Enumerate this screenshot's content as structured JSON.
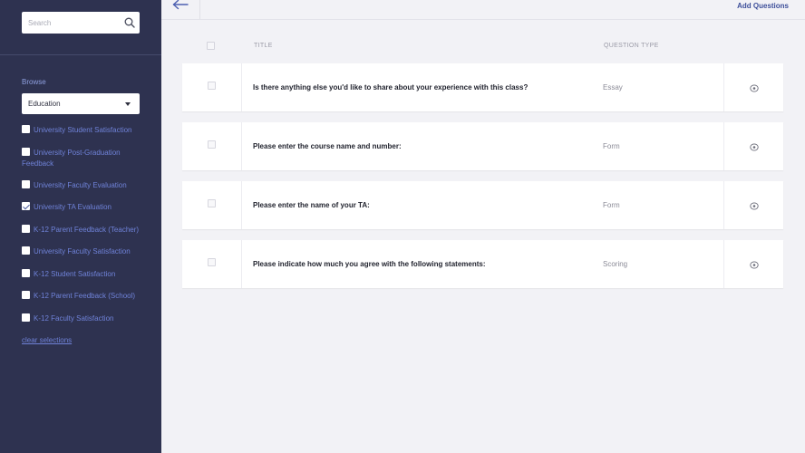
{
  "sidebar": {
    "search": {
      "placeholder": "Search"
    },
    "browse_label": "Browse",
    "category_select": {
      "selected": "Education"
    },
    "categories": [
      {
        "label": "University Student Satisfaction",
        "checked": false
      },
      {
        "label": "University Post-Graduation Feedback",
        "checked": false
      },
      {
        "label": "University Faculty Evaluation",
        "checked": false
      },
      {
        "label": "University TA Evaluation",
        "checked": true
      },
      {
        "label": "K-12 Parent Feedback (Teacher)",
        "checked": false
      },
      {
        "label": "University Faculty Satisfaction",
        "checked": false
      },
      {
        "label": "K-12 Student Satisfaction",
        "checked": false
      },
      {
        "label": "K-12 Parent Feedback (School)",
        "checked": false
      },
      {
        "label": "K-12 Faculty Satisfaction",
        "checked": false
      }
    ],
    "clear_label": "clear selections"
  },
  "topbar": {
    "back_icon": "arrow-left-icon",
    "add_questions_label": "Add Questions"
  },
  "table": {
    "columns": {
      "title": "TITLE",
      "type": "QUESTION TYPE"
    },
    "rows": [
      {
        "title": "Is there anything else you'd like to share about your experience with this class?",
        "type": "Essay",
        "icon": "eye-icon"
      },
      {
        "title": "Please enter the course name and number:",
        "type": "Form",
        "icon": "eye-icon"
      },
      {
        "title": "Please enter the name of your TA:",
        "type": "Form",
        "icon": "eye-icon"
      },
      {
        "title": "Please indicate how much you agree with the following statements:",
        "type": "Scoring",
        "icon": "eye-icon"
      }
    ]
  },
  "colors": {
    "sidebar_bg": "#2e3250",
    "link": "#6f82d8",
    "accent": "#3d4f9a",
    "page_bg": "#f2f2f6"
  }
}
